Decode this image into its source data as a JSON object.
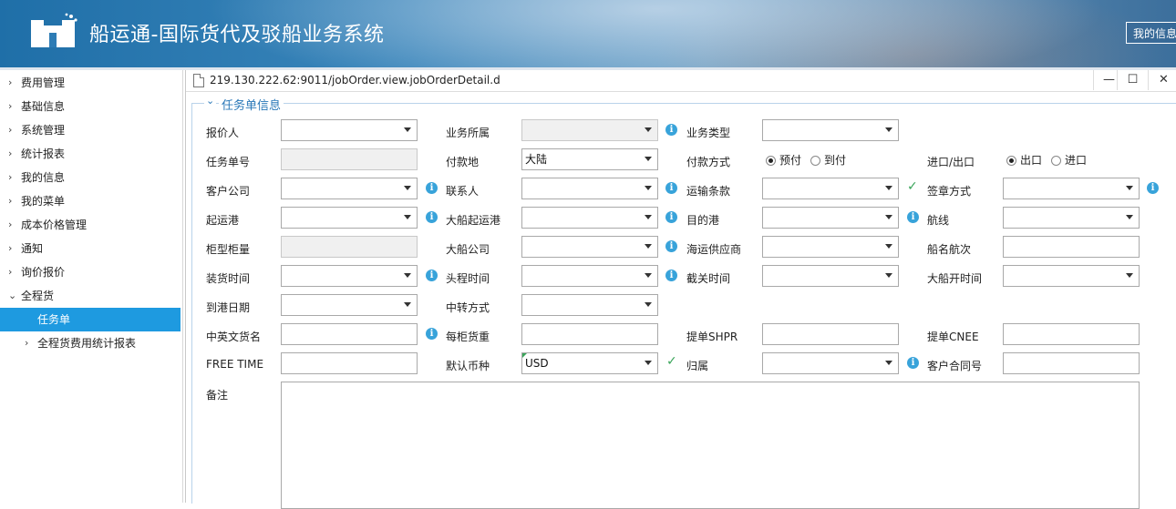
{
  "header": {
    "app_title": "船运通-国际货代及驳船业务系统",
    "my_info_button": "我的信息"
  },
  "sidebar": {
    "items": [
      {
        "label": "费用管理",
        "arrow": "›"
      },
      {
        "label": "基础信息",
        "arrow": "›"
      },
      {
        "label": "系统管理",
        "arrow": "›"
      },
      {
        "label": "统计报表",
        "arrow": "›"
      },
      {
        "label": "我的信息",
        "arrow": "›"
      },
      {
        "label": "我的菜单",
        "arrow": "›"
      },
      {
        "label": "成本价格管理",
        "arrow": "›"
      },
      {
        "label": "通知",
        "arrow": "›"
      },
      {
        "label": "询价报价",
        "arrow": "›"
      },
      {
        "label": "全程货",
        "arrow": "⌄"
      },
      {
        "label": "任务单",
        "arrow": "",
        "active": true
      },
      {
        "label": "全程货费用统计报表",
        "arrow": "›"
      }
    ]
  },
  "dialog": {
    "url": "219.130.222.62:9011/jobOrder.view.jobOrderDetail.d",
    "minimize": "—",
    "maximize": "☐",
    "close": "✕",
    "section_title": "任务单信息",
    "section_chevron": "⌄"
  },
  "form": {
    "quoter_label": "报价人",
    "business_owner_label": "业务所属",
    "business_type_label": "业务类型",
    "task_no_label": "任务单号",
    "payment_place_label": "付款地",
    "payment_place_value": "大陆",
    "payment_method_label": "付款方式",
    "payment_prepaid": "预付",
    "payment_collect": "到付",
    "import_export_label": "进口/出口",
    "export_option": "出口",
    "import_option": "进口",
    "customer_company_label": "客户公司",
    "contact_label": "联系人",
    "shipping_terms_label": "运输条款",
    "stamp_method_label": "签章方式",
    "pol_label": "起运港",
    "vessel_pol_label": "大船起运港",
    "destination_label": "目的港",
    "route_label": "航线",
    "container_label": "柜型柜量",
    "vessel_company_label": "大船公司",
    "ocean_supplier_label": "海运供应商",
    "vessel_voyage_label": "船名航次",
    "loading_time_label": "装货时间",
    "first_leg_time_label": "头程时间",
    "cutoff_time_label": "截关时间",
    "vessel_departure_label": "大船开时间",
    "arrival_date_label": "到港日期",
    "transship_label": "中转方式",
    "goods_name_label": "中英文货名",
    "weight_per_container_label": "每柜货重",
    "bl_shipper_label": "提单SHPR",
    "bl_consignee_label": "提单CNEE",
    "free_time_label": "FREE TIME",
    "default_currency_label": "默认币种",
    "default_currency_value": "USD",
    "belongs_label": "归属",
    "customer_contract_label": "客户合同号",
    "remarks_label": "备注"
  }
}
